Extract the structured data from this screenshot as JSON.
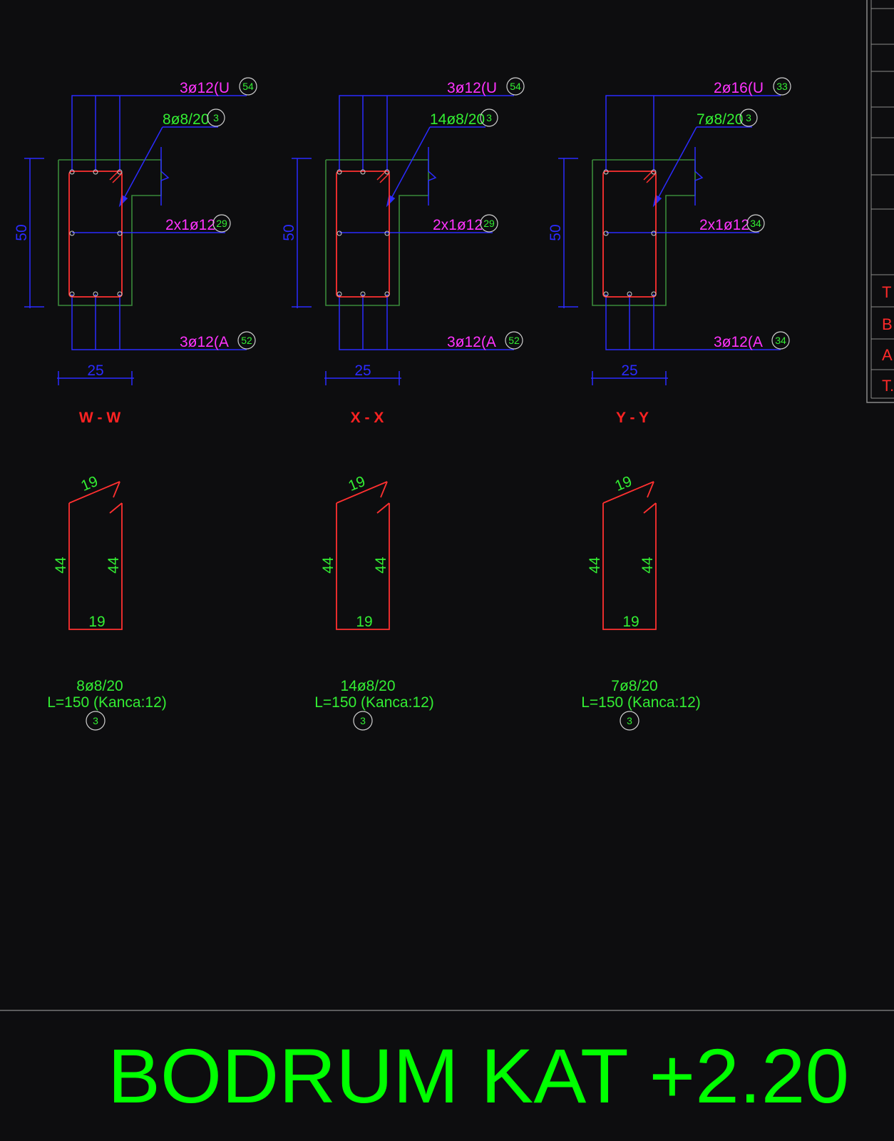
{
  "sections": [
    {
      "name": "W - W",
      "top_bar": "3ø12(U",
      "top_bar_mark": "54",
      "stirrup": "8ø8/20",
      "stirrup_mark": "3",
      "side_bar": "2x1ø12",
      "side_bar_mark": "29",
      "bottom_bar": "3ø12(A",
      "bottom_bar_mark": "52",
      "height": "50",
      "width": "25",
      "shape_top": "19",
      "shape_bottom": "19",
      "shape_left": "44",
      "shape_right": "44",
      "note_count": "8ø8/20",
      "note_length": "L=150 (Kanca:12)",
      "note_mark": "3"
    },
    {
      "name": "X - X",
      "top_bar": "3ø12(U",
      "top_bar_mark": "54",
      "stirrup": "14ø8/20",
      "stirrup_mark": "3",
      "side_bar": "2x1ø12",
      "side_bar_mark": "29",
      "bottom_bar": "3ø12(A",
      "bottom_bar_mark": "52",
      "height": "50",
      "width": "25",
      "shape_top": "19",
      "shape_bottom": "19",
      "shape_left": "44",
      "shape_right": "44",
      "note_count": "14ø8/20",
      "note_length": "L=150 (Kanca:12)",
      "note_mark": "3"
    },
    {
      "name": "Y - Y",
      "top_bar": "2ø16(U",
      "top_bar_mark": "33",
      "stirrup": "7ø8/20",
      "stirrup_mark": "3",
      "side_bar": "2x1ø12",
      "side_bar_mark": "34",
      "bottom_bar": "3ø12(A",
      "bottom_bar_mark": "34",
      "height": "50",
      "width": "25",
      "shape_top": "19",
      "shape_bottom": "19",
      "shape_left": "44",
      "shape_right": "44",
      "note_count": "7ø8/20",
      "note_length": "L=150 (Kanca:12)",
      "note_mark": "3"
    }
  ],
  "side_table_labels": [
    "T",
    "B",
    "A",
    "T."
  ],
  "footer_title": "BODRUM KAT +2.20",
  "colors": {
    "background": "#0d0d0f",
    "concrete": "#3a8a3a",
    "rebar": "#ff3030",
    "dimension": "#2b2bff",
    "bar_label": "#ff33ff",
    "annotation": "#33ee33",
    "table_frame": "#8a8a8a"
  }
}
